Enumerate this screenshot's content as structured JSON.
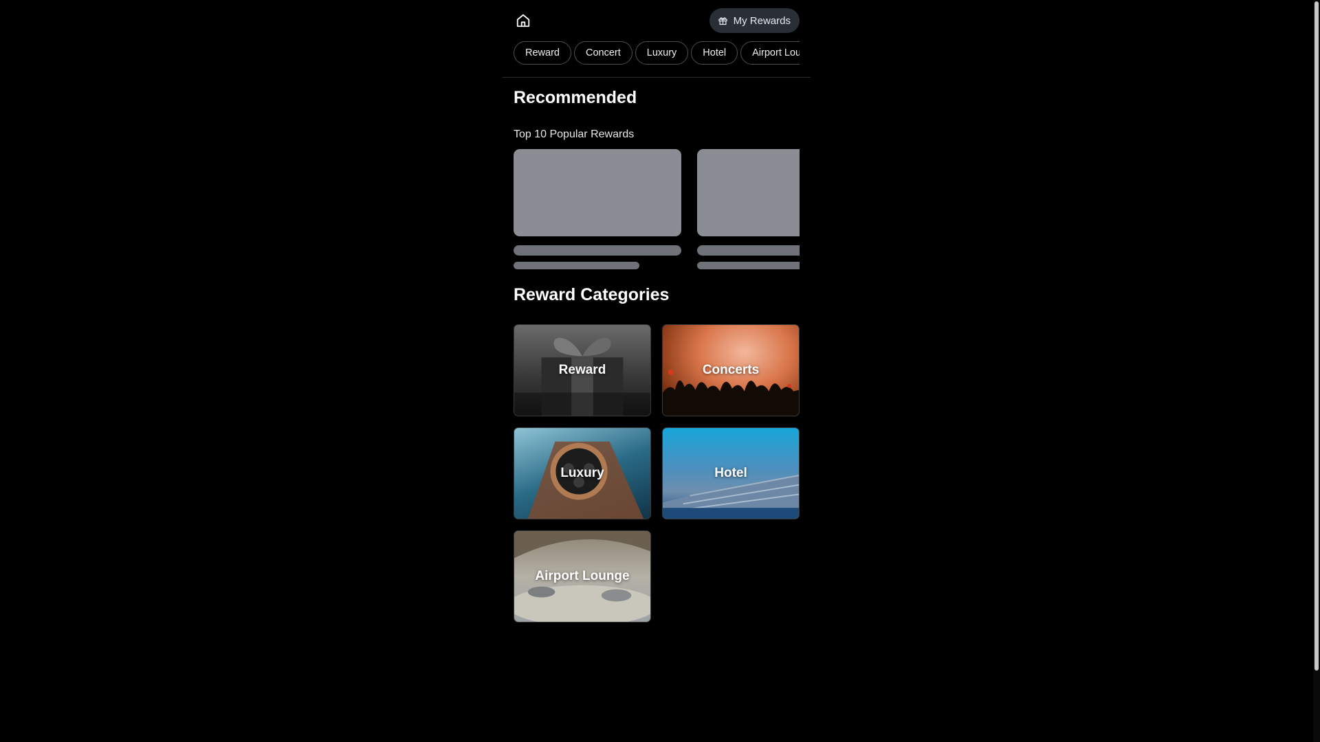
{
  "header": {
    "my_rewards_label": "My Rewards"
  },
  "chips": [
    "Reward",
    "Concert",
    "Luxury",
    "Hotel",
    "Airport Lounge"
  ],
  "recommended": {
    "title": "Recommended",
    "subtitle": "Top 10 Popular Rewards"
  },
  "categories": {
    "title": "Reward Categories",
    "tiles": [
      "Reward",
      "Concerts",
      "Luxury",
      "Hotel",
      "Airport Lounge"
    ]
  },
  "colors": {
    "background": "#000000",
    "skeleton": "#8a8d93",
    "rewards_button_bg": "#2a2f37"
  }
}
